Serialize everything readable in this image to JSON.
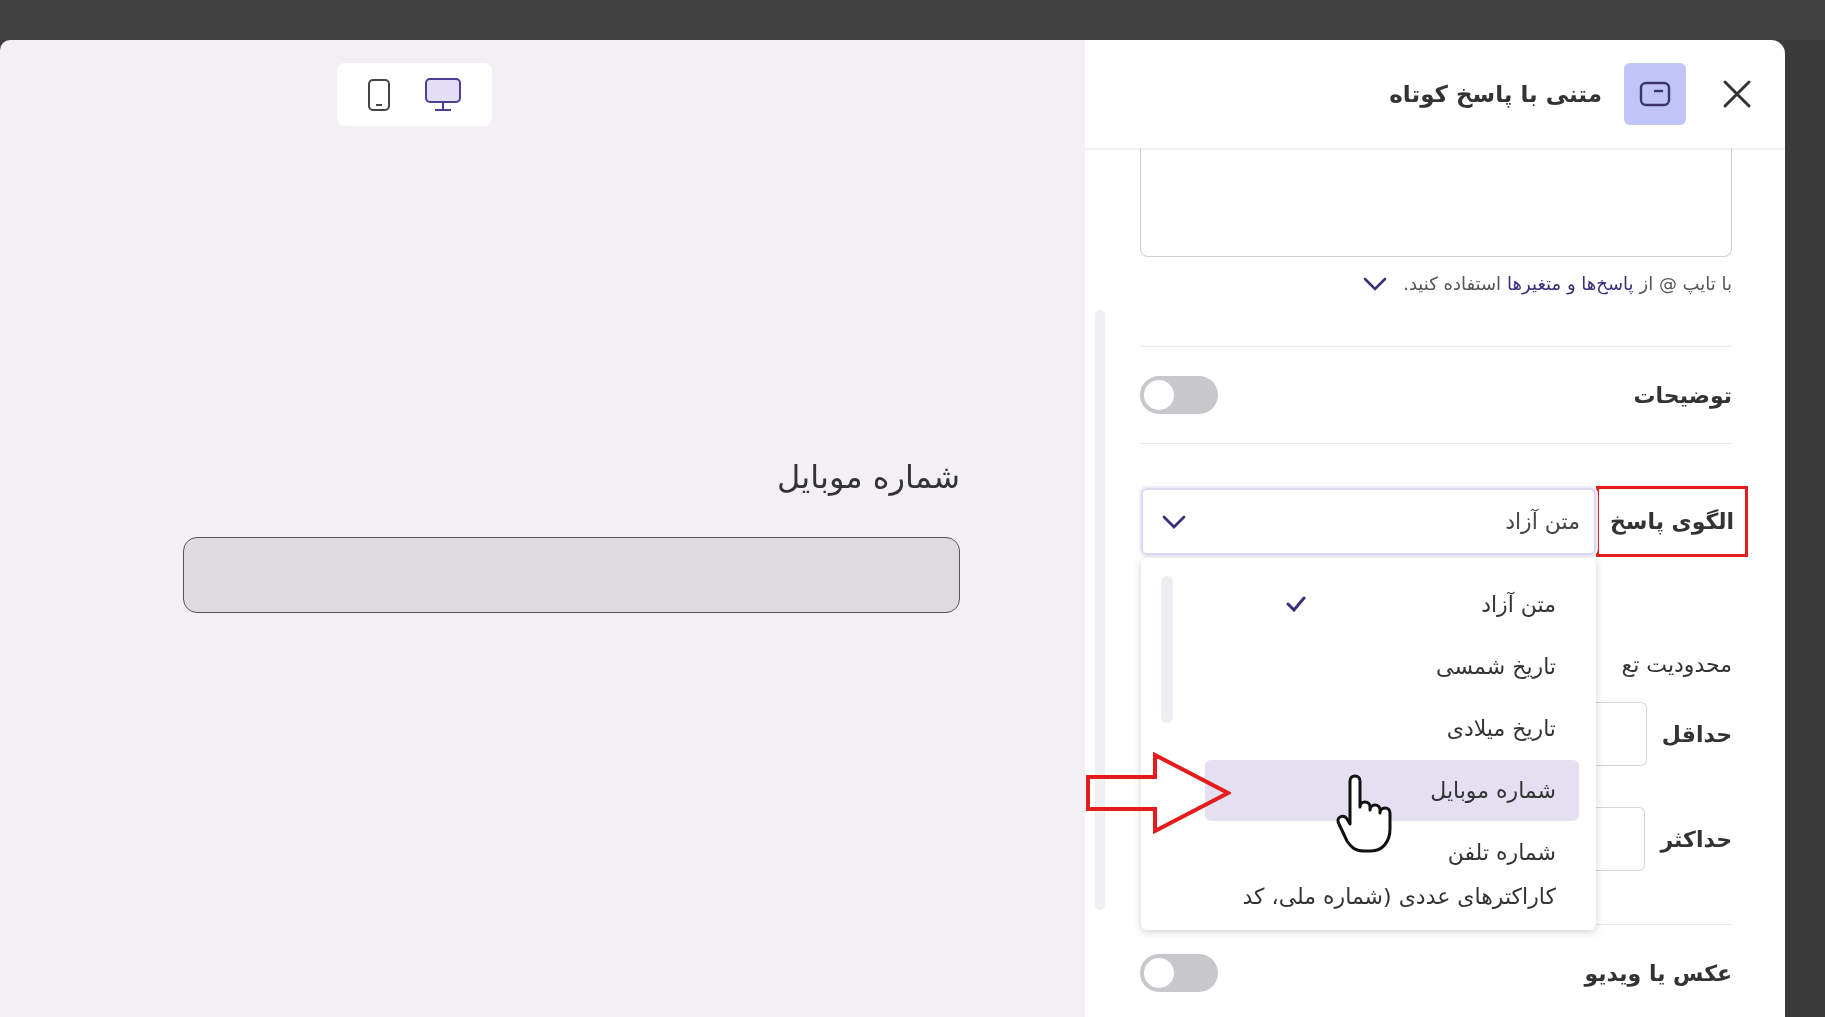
{
  "devices": [
    {
      "kind": "mobile",
      "selected": false
    },
    {
      "kind": "desktop",
      "selected": true
    }
  ],
  "preview": {
    "question": "شماره موبایل"
  },
  "panel": {
    "title": "متنی با پاسخ کوتاه"
  },
  "hint": {
    "before": "با تایپ @ از",
    "link": "پاسخ‌ها و متغیرها",
    "after": "استفاده کنید."
  },
  "description": {
    "label": "توضیحات",
    "on": false
  },
  "answer_pattern": {
    "label": "الگوی پاسخ",
    "highlighted": true,
    "value": "متن آزاد",
    "expanded": true,
    "options": [
      {
        "label": "متن آزاد",
        "selected": true,
        "hovered": false
      },
      {
        "label": "تاریخ شمسی",
        "selected": false,
        "hovered": false
      },
      {
        "label": "تاریخ میلادی",
        "selected": false,
        "hovered": false
      },
      {
        "label": "شماره موبایل",
        "selected": false,
        "hovered": true
      },
      {
        "label": "شماره تلفن",
        "selected": false,
        "hovered": false
      },
      {
        "label": "کاراکترهای عددی (شماره ملی، کد",
        "selected": false,
        "hovered": false
      }
    ]
  },
  "limit": {
    "label": "محدودیت تع",
    "min_label": "حداقل",
    "max_label": "حداکثر"
  },
  "media": {
    "label": "عکس یا ویدیو",
    "on": false
  },
  "pointer_arrow": true
}
